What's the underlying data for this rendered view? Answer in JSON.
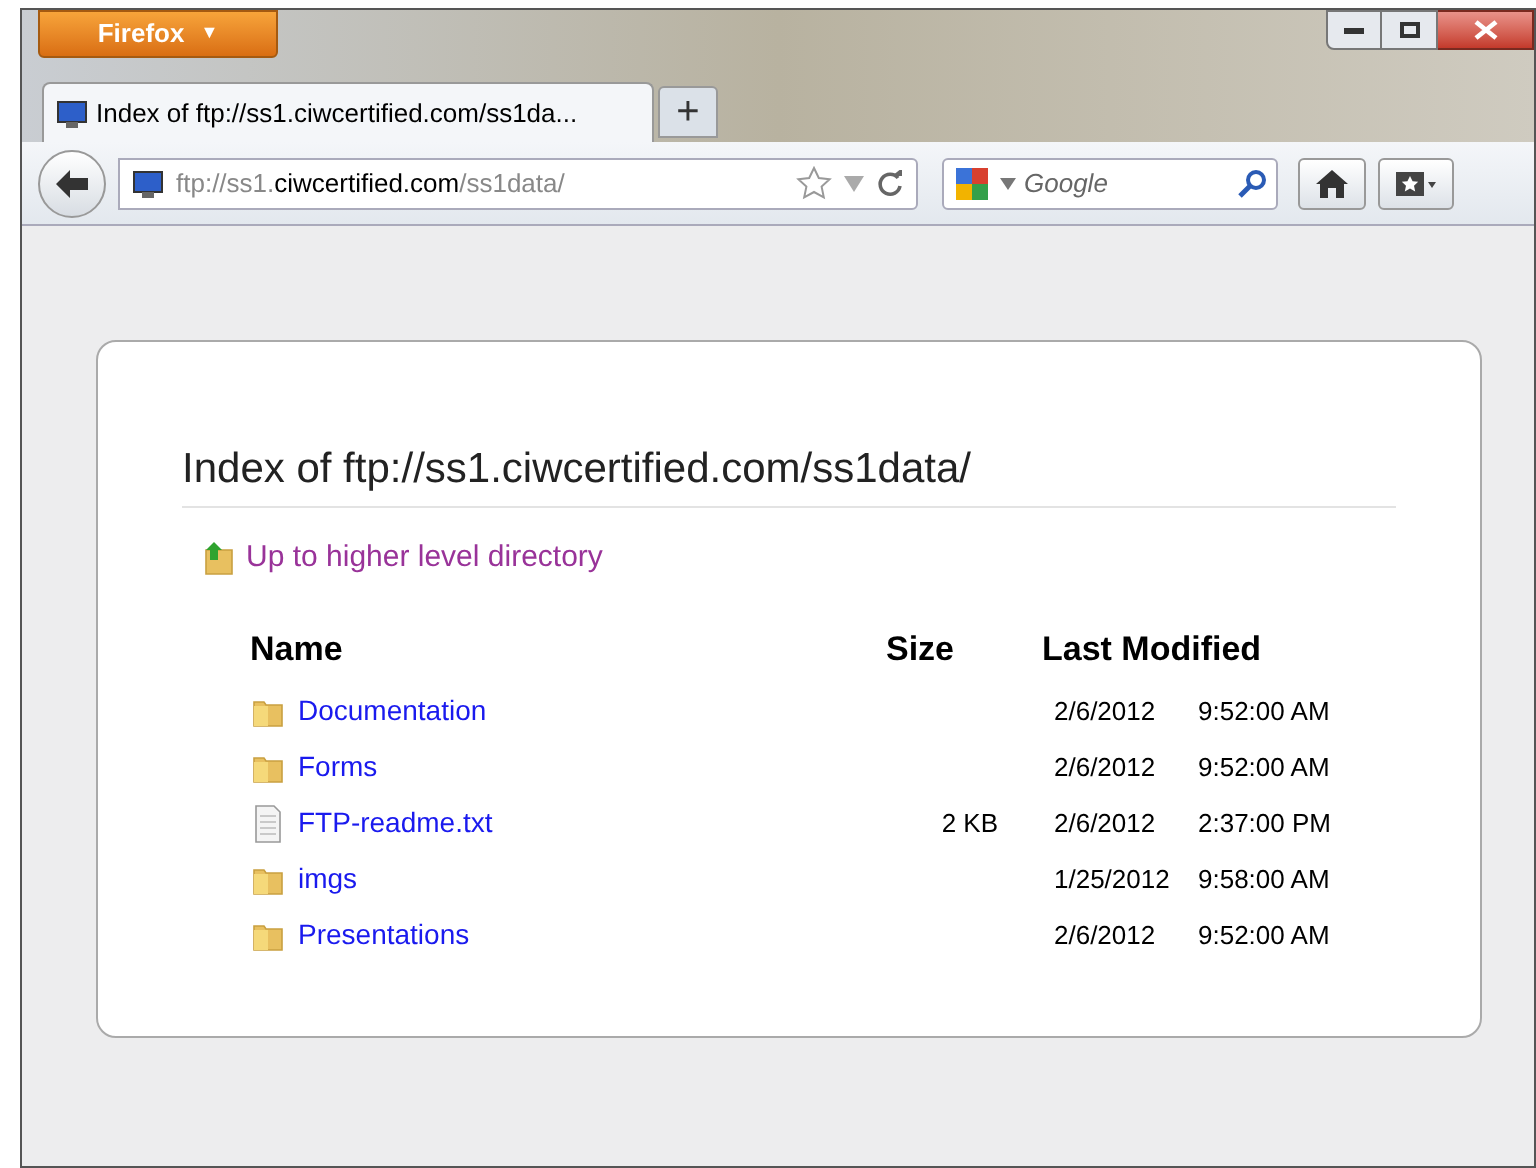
{
  "app_button": {
    "label": "Firefox",
    "caret": "▼"
  },
  "tabs": [
    {
      "title": "Index of ftp://ss1.ciwcertified.com/ss1da...",
      "selected": true
    }
  ],
  "new_tab": "+",
  "address": {
    "prefix": "ftp://ss1.",
    "domain": "ciwcertified.com",
    "path": "/ss1data/"
  },
  "search": {
    "placeholder": "Google"
  },
  "page": {
    "heading": "Index of ftp://ss1.ciwcertified.com/ss1data/",
    "up_link": "Up to higher level directory",
    "columns": [
      "Name",
      "Size",
      "Last Modified"
    ],
    "rows": [
      {
        "kind": "folder",
        "name": "Documentation",
        "size": "",
        "date": "2/6/2012",
        "time": "9:52:00 AM"
      },
      {
        "kind": "folder",
        "name": "Forms",
        "size": "",
        "date": "2/6/2012",
        "time": "9:52:00 AM"
      },
      {
        "kind": "file",
        "name": "FTP-readme.txt",
        "size": "2 KB",
        "date": "2/6/2012",
        "time": "2:37:00 PM"
      },
      {
        "kind": "folder",
        "name": "imgs",
        "size": "",
        "date": "1/25/2012",
        "time": "9:58:00 AM"
      },
      {
        "kind": "folder",
        "name": "Presentations",
        "size": "",
        "date": "2/6/2012",
        "time": "9:52:00 AM"
      }
    ]
  }
}
